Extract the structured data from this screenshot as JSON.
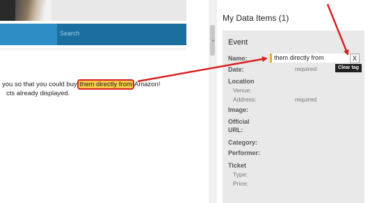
{
  "navbar": {
    "search_placeholder": "Search"
  },
  "content": {
    "line1_before": "you so that you could buy ",
    "line1_highlight": "them directly from",
    "line1_after": " Amazon!",
    "line2": "cts already displayed."
  },
  "panel": {
    "title": "My Data Items (1)",
    "card_title": "Event",
    "fields": {
      "name_label": "Name:",
      "name_value": "them directly from",
      "clear_button": "X",
      "clear_tooltip": "Clear tag",
      "date_label": "Date:",
      "date_required": "required",
      "location_label": "Location",
      "venue_label": "Venue:",
      "address_label": "Address:",
      "address_required": "required",
      "image_label": "Image:",
      "official_label_1": "Official",
      "official_label_2": "URL:",
      "category_label": "Category:",
      "performer_label": "Performer:",
      "ticket_label": "Ticket",
      "type_label": "Type:",
      "price_label": "Price:"
    }
  },
  "colors": {
    "highlight": "#f9c84a",
    "annotation_red": "#d62020",
    "nav_blue": "#1a6f9f",
    "field_accent": "#f5a623"
  },
  "icons": {
    "scroll_grip": "grip-icon"
  }
}
